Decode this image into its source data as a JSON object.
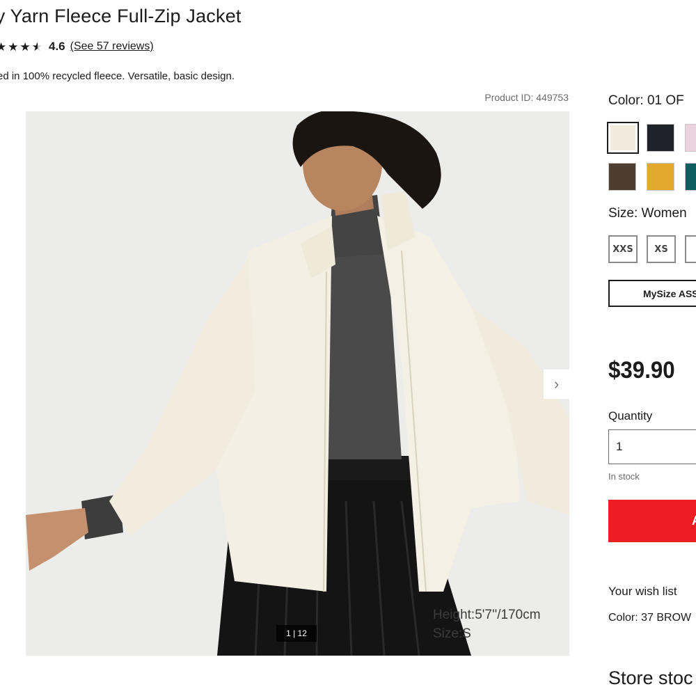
{
  "product": {
    "title": "fy Yarn Fleece Full-Zip Jacket",
    "rating_value": "4.6",
    "reviews_link": "(See 57 reviews)",
    "description": "ed in 100% recycled fleece. Versatile, basic design.",
    "product_id": "Product ID: 449753",
    "rating_stars_shown": 3.5
  },
  "gallery": {
    "pager": "1 | 12",
    "model_height": "Height:5'7''/170cm",
    "model_size": "Size:S",
    "next_icon": "›"
  },
  "color": {
    "label": "Color:  01 OF",
    "swatches": [
      {
        "name": "off-white",
        "hex": "#f0ebdd",
        "selected": true
      },
      {
        "name": "navy-black",
        "hex": "#1f2329"
      },
      {
        "name": "pink",
        "hex": "#ecd2dc"
      },
      {
        "name": "brown",
        "hex": "#4d3d30"
      },
      {
        "name": "yellow",
        "hex": "#e2a92c"
      },
      {
        "name": "teal",
        "hex": "#0e5e60"
      }
    ]
  },
  "size": {
    "label": "Size:  Women",
    "options": [
      "XXS",
      "XS",
      ""
    ]
  },
  "mysize_button": "MySize ASS",
  "price": "$39.90",
  "quantity": {
    "label": "Quantity",
    "value": "1",
    "stock_status": "In stock"
  },
  "add_button": "A",
  "wishlist": {
    "label": "Your wish list",
    "color": "Color: 37 BROW"
  },
  "store_stock": "Store stoc",
  "colors": {
    "accent_red": "#ed1d24",
    "text": "#1b1b1b",
    "muted": "#6b6b6b"
  }
}
